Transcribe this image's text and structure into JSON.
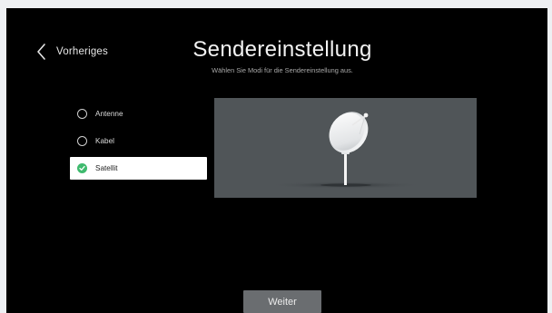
{
  "header": {
    "back_label": "Vorheriges",
    "title": "Sendereinstellung",
    "subtitle": "Wählen Sie Modi für die Sendereinstellung aus."
  },
  "options": [
    {
      "label": "Antenne",
      "selected": false
    },
    {
      "label": "Kabel",
      "selected": false
    },
    {
      "label": "Satellit",
      "selected": true
    }
  ],
  "illustration": {
    "icon": "satellite-dish-icon"
  },
  "footer": {
    "continue_label": "Weiter"
  },
  "colors": {
    "background": "#000000",
    "selected_bg": "#ffffff",
    "check_green": "#3fba6e",
    "illustration_bg": "#505558",
    "button_bg": "#6a6d70"
  }
}
